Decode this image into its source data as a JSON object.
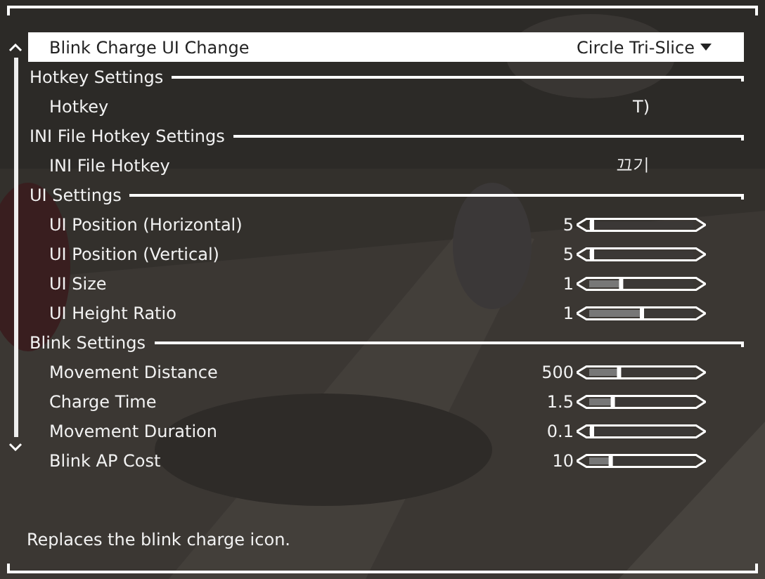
{
  "option": {
    "label": "Blink Charge UI Change",
    "value": "Circle Tri-Slice",
    "selected": true
  },
  "sections": [
    {
      "title": "Hotkey Settings",
      "items": [
        {
          "kind": "text",
          "label": "Hotkey",
          "value": "T)"
        }
      ]
    },
    {
      "title": "INI File Hotkey Settings",
      "items": [
        {
          "kind": "text",
          "label": "INI File Hotkey",
          "value": "끄기"
        }
      ]
    },
    {
      "title": "UI Settings",
      "items": [
        {
          "kind": "slider",
          "label": "UI Position (Horizontal)",
          "value": "5",
          "level": 0.02
        },
        {
          "kind": "slider",
          "label": "UI Position (Vertical)",
          "value": "5",
          "level": 0.02
        },
        {
          "kind": "slider",
          "label": "UI Size",
          "value": "1",
          "level": 0.3
        },
        {
          "kind": "slider",
          "label": "UI Height Ratio",
          "value": "1",
          "level": 0.5
        }
      ]
    },
    {
      "title": "Blink Settings",
      "items": [
        {
          "kind": "slider",
          "label": "Movement Distance",
          "value": "500",
          "level": 0.28
        },
        {
          "kind": "slider",
          "label": "Charge Time",
          "value": "1.5",
          "level": 0.22
        },
        {
          "kind": "slider",
          "label": "Movement Duration",
          "value": "0.1",
          "level": 0.02
        },
        {
          "kind": "slider",
          "label": "Blink AP Cost",
          "value": "10",
          "level": 0.2
        }
      ]
    }
  ],
  "description": "Replaces the blink charge icon."
}
